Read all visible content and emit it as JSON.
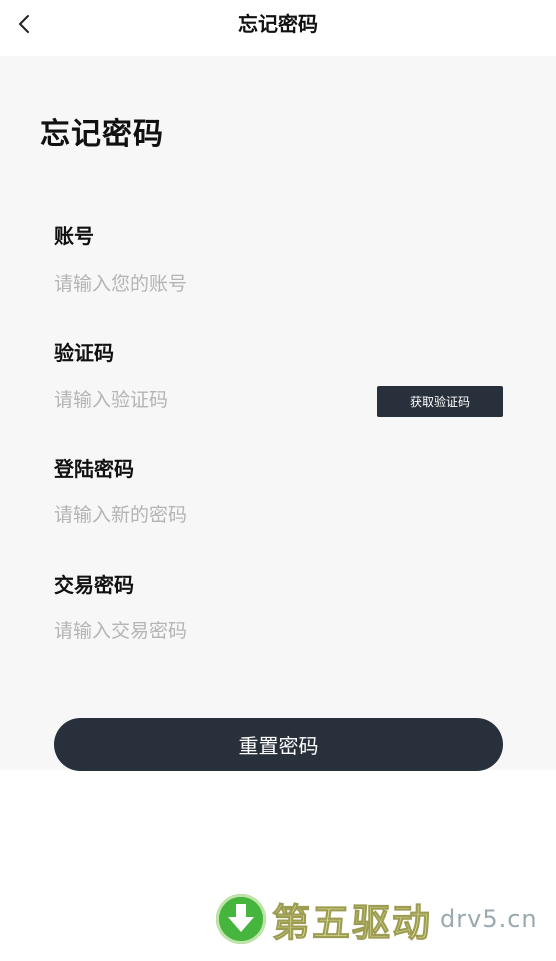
{
  "nav": {
    "title": "忘记密码"
  },
  "heading": "忘记密码",
  "fields": [
    {
      "label": "账号",
      "placeholder": "请输入您的账号"
    },
    {
      "label": "验证码",
      "placeholder": "请输入验证码"
    },
    {
      "label": "登陆密码",
      "placeholder": "请输入新的密码"
    },
    {
      "label": "交易密码",
      "placeholder": "请输入交易密码"
    }
  ],
  "code_button": "获取验证码",
  "submit_button": "重置密码",
  "watermark": {
    "text": "第五驱动",
    "domain": "drv5.cn"
  },
  "colors": {
    "button_bg": "#27303b",
    "content_bg": "#f7f7f8",
    "placeholder": "#b4b4b4"
  },
  "icons": {
    "back": "chevron-left-icon",
    "watermark_logo": "download-arrow-icon"
  }
}
